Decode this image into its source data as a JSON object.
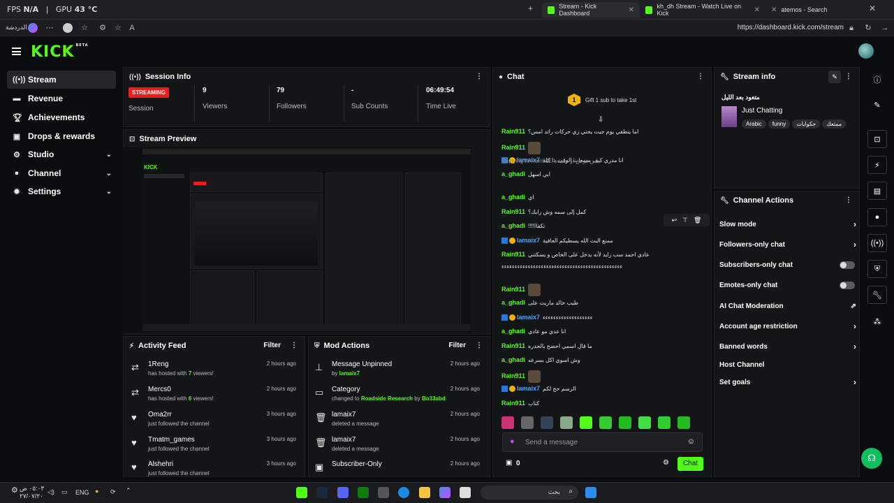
{
  "os": {
    "fps_label": "FPS",
    "fps_value": "N/A",
    "gpu_label": "GPU",
    "gpu_value": "43 °C"
  },
  "browser": {
    "tabs": [
      {
        "title": "Stream - Kick Dashboard",
        "active": true
      },
      {
        "title": "kh_dh Stream - Watch Live on Kick",
        "active": false
      },
      {
        "title": "atemos - Search",
        "active": false
      }
    ],
    "left_label": "الدردشة",
    "url": "https://dashboard.kick.com/stream"
  },
  "app": {
    "logo": "KICK",
    "logo_sup": "BETA"
  },
  "nav": [
    {
      "label": "Stream",
      "icon": "broadcast-icon",
      "active": true
    },
    {
      "label": "Revenue",
      "icon": "money-icon"
    },
    {
      "label": "Achievements",
      "icon": "trophy-icon"
    },
    {
      "label": "Drops & rewards",
      "icon": "gift-icon"
    },
    {
      "label": "Studio",
      "icon": "settings-icon",
      "expandable": true
    },
    {
      "label": "Channel",
      "icon": "person-icon",
      "expandable": true
    },
    {
      "label": "Settings",
      "icon": "gear-icon",
      "expandable": true
    }
  ],
  "session": {
    "title": "Session Info",
    "status": "STREAMING",
    "status_label": "Session",
    "stats": [
      {
        "value": "9",
        "label": "Viewers"
      },
      {
        "value": "79",
        "label": "Followers"
      },
      {
        "value": "-",
        "label": "Sub Counts"
      },
      {
        "value": "06:49:54",
        "label": "Time Live"
      }
    ]
  },
  "preview": {
    "title": "Stream Preview"
  },
  "activity": {
    "title": "Activity Feed",
    "filter": "Filter",
    "items": [
      {
        "name": "1Reng",
        "pre": "has hosted with ",
        "count": "7",
        "post": " viewers!",
        "time": "2 hours ago",
        "icon": "host-icon"
      },
      {
        "name": "Mercs0",
        "pre": "has hosted with ",
        "count": "6",
        "post": " viewers!",
        "time": "2 hours ago",
        "icon": "host-icon"
      },
      {
        "name": "Oma2rr",
        "pre": "just followed the channel",
        "count": "",
        "post": "",
        "time": "3 hours ago",
        "icon": "heart-icon"
      },
      {
        "name": "Tmatm_games",
        "pre": "just followed the channel",
        "count": "",
        "post": "",
        "time": "3 hours ago",
        "icon": "heart-icon"
      },
      {
        "name": "Alshehri",
        "pre": "just followed the channel",
        "count": "",
        "post": "",
        "time": "3 hours ago",
        "icon": "heart-icon"
      }
    ]
  },
  "mod": {
    "title": "Mod Actions",
    "filter": "Filter",
    "items": [
      {
        "name": "Message Unpinned",
        "pre": "by ",
        "link": "lamaix7",
        "mid": "",
        "link2": "",
        "time": "2 hours ago",
        "icon": "unpin-icon"
      },
      {
        "name": "Category",
        "pre": "changed to ",
        "link": "Roadside Research",
        "mid": " by ",
        "link2": "Bo33abd",
        "time": "2 hours ago",
        "icon": "category-icon"
      },
      {
        "name": "lamaix7",
        "pre": "deleted a message",
        "link": "",
        "mid": "",
        "link2": "",
        "time": "2 hours ago",
        "icon": "trash-icon"
      },
      {
        "name": "lamaix7",
        "pre": "deleted a message",
        "link": "",
        "mid": "",
        "link2": "",
        "time": "2 hours ago",
        "icon": "trash-icon"
      },
      {
        "name": "Subscriber-Only",
        "pre": "",
        "link": "",
        "mid": "",
        "link2": "",
        "time": "2 hours ago",
        "icon": "gift-icon"
      }
    ]
  },
  "chat": {
    "title": "Chat",
    "gift_count": "1",
    "gift_text": "Gift 1 sub to take 1st",
    "messages": [
      {
        "user": "Rain911",
        "color": "gr",
        "text": "اما يتطفي يوم جيت يحني زي حركات راتد امس؟",
        "badges": ""
      },
      {
        "user": "Rain911",
        "color": "gr",
        "text": "",
        "emote": true,
        "badges": ""
      },
      {
        "user": "lamaix7",
        "color": "bl",
        "text": "انا مدري كيف سمعات الوقت ذا كله",
        "badges": "mod"
      },
      {
        "user": "a_ghadi",
        "color": "gr",
        "text": "ابي اسهل",
        "badges": "",
        "reply": "Replying to Rain911: امس قرص أو تصيده"
      },
      {
        "user": "a_ghadi",
        "color": "gr",
        "text": "اي",
        "badges": ""
      },
      {
        "user": "Rain911",
        "color": "gr",
        "text": "كمل إلى سمه وش رايك؟",
        "badges": ""
      },
      {
        "user": "a_ghadi",
        "color": "gr",
        "text": "!!!!تكفاا",
        "badges": ""
      },
      {
        "user": "lamaix7",
        "color": "bl",
        "text": "ممنع البث الله يسطيكم العافية",
        "badges": "mod"
      },
      {
        "user": "Rain911",
        "color": "gr",
        "text": "عادي احمد سب رايد لأنه يدخل على الخاص و يسكتني",
        "badges": ""
      },
      {
        "user": "",
        "color": "gr",
        "text": "ءءءءءءءءءءءءءءءءءءءءءءءءءءءءءءءءءءءءءءءءءءءءءء",
        "badges": ""
      },
      {
        "user": "Rain911",
        "color": "gr",
        "text": "",
        "emote": true,
        "badges": ""
      },
      {
        "user": "a_ghadi",
        "color": "gr",
        "text": "طيب خالد ماريت على",
        "badges": ""
      },
      {
        "user": "lamaix7",
        "color": "bl",
        "text": "ءءءءءءءءءءءءءءءءءءء",
        "badges": "mod"
      },
      {
        "user": "a_ghadi",
        "color": "gr",
        "text": "انا عدي مو عادي",
        "badges": ""
      },
      {
        "user": "Rain911",
        "color": "gr",
        "text": "ما قال اسمي احضح بالحدره",
        "badges": ""
      },
      {
        "user": "a_ghadi",
        "color": "gr",
        "text": "وش اسوي اكل بسرعه",
        "badges": ""
      },
      {
        "user": "Rain911",
        "color": "gr",
        "text": "",
        "emote": true,
        "badges": ""
      },
      {
        "user": "lamaix7",
        "color": "bl",
        "text": "الرسم حج لكم",
        "badges": "mod"
      },
      {
        "user": "Rain911",
        "color": "gr",
        "text": "كتاب",
        "badges": ""
      }
    ],
    "input_placeholder": "Send a message",
    "points": "0",
    "send_label": "Chat"
  },
  "stream_info": {
    "title": "Stream info",
    "stream_title": "متعود بعد الليل",
    "category": "Just Chatting",
    "tags": [
      "Arabic",
      "funny",
      "حكوايات",
      "ممتعك"
    ]
  },
  "channel_actions": {
    "title": "Channel Actions",
    "items": [
      {
        "label": "Slow mode",
        "control": "chevron"
      },
      {
        "label": "Followers-only chat",
        "control": "chevron"
      },
      {
        "label": "Subscribers-only chat",
        "control": "toggle"
      },
      {
        "label": "Emotes-only chat",
        "control": "toggle"
      },
      {
        "label": "AI Chat Moderation",
        "control": "external"
      },
      {
        "label": "Account age restriction",
        "control": "chevron"
      },
      {
        "label": "Banned words",
        "control": "chevron"
      },
      {
        "label": "Host Channel",
        "control": "none"
      },
      {
        "label": "Set goals",
        "control": "chevron"
      }
    ]
  },
  "taskbar": {
    "time": "٠٥:٠٣ ص",
    "date": "٢٧/٠٧/٢٠",
    "lang": "ENG",
    "search": "بحث"
  },
  "colors": {
    "accent": "#53fc18",
    "live": "#e91e1e",
    "panel": "#141517",
    "bg": "#0b0c0d"
  }
}
